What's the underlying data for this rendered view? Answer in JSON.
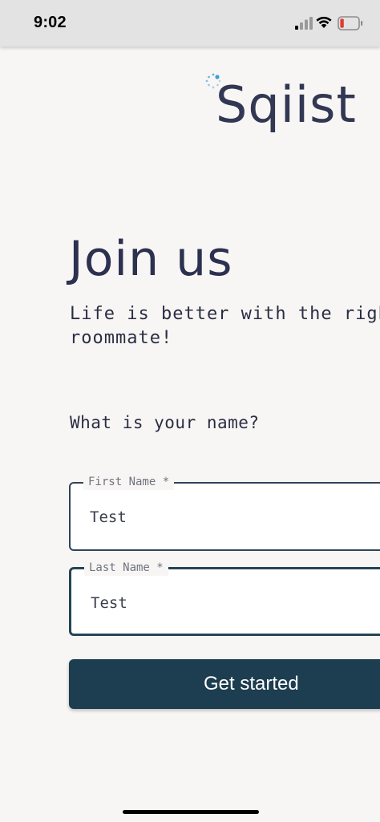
{
  "status_bar": {
    "time": "9:02",
    "icons": [
      "signal-icon",
      "wifi-icon",
      "battery-low-icon"
    ],
    "battery_color": "#e03b30"
  },
  "brand": {
    "name": "Sqiist",
    "spinner_color": "#3aa0d8",
    "text_color": "#323753"
  },
  "page": {
    "title": "Join us",
    "subtitle": "Life is better with the right roommate!"
  },
  "form": {
    "question": "What is your name?",
    "first_name": {
      "label": "First Name *",
      "value": "Test"
    },
    "last_name": {
      "label": "Last Name *",
      "value": "Test"
    },
    "submit_label": "Get started"
  },
  "colors": {
    "background": "#f8f6f4",
    "primary": "#1d3d50",
    "field_border": "#2f4458"
  }
}
